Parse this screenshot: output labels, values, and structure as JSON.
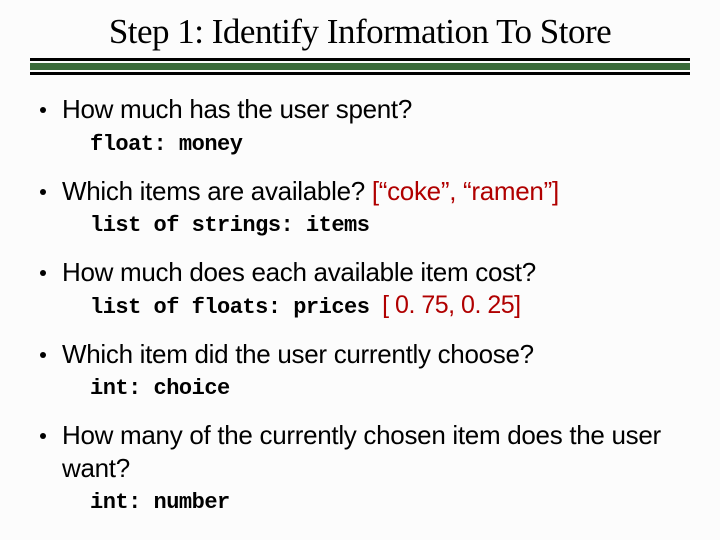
{
  "title": "Step 1: Identify Information To Store",
  "bullets": [
    {
      "text": "How much has the user spent?",
      "annot": "",
      "code": "float: money",
      "code_annot": ""
    },
    {
      "text": "Which items are available? ",
      "annot": "[“coke”, “ramen”]",
      "code": "list of strings: items",
      "code_annot": ""
    },
    {
      "text": "How much does each available item cost?",
      "annot": "",
      "code": "list of floats: prices ",
      "code_annot": "[ 0. 75, 0. 25]"
    },
    {
      "text": "Which item did the user currently choose?",
      "annot": "",
      "code": "int: choice",
      "code_annot": ""
    },
    {
      "text": "How many of the currently chosen item does the user want?",
      "annot": "",
      "code": "int: number",
      "code_annot": ""
    }
  ]
}
